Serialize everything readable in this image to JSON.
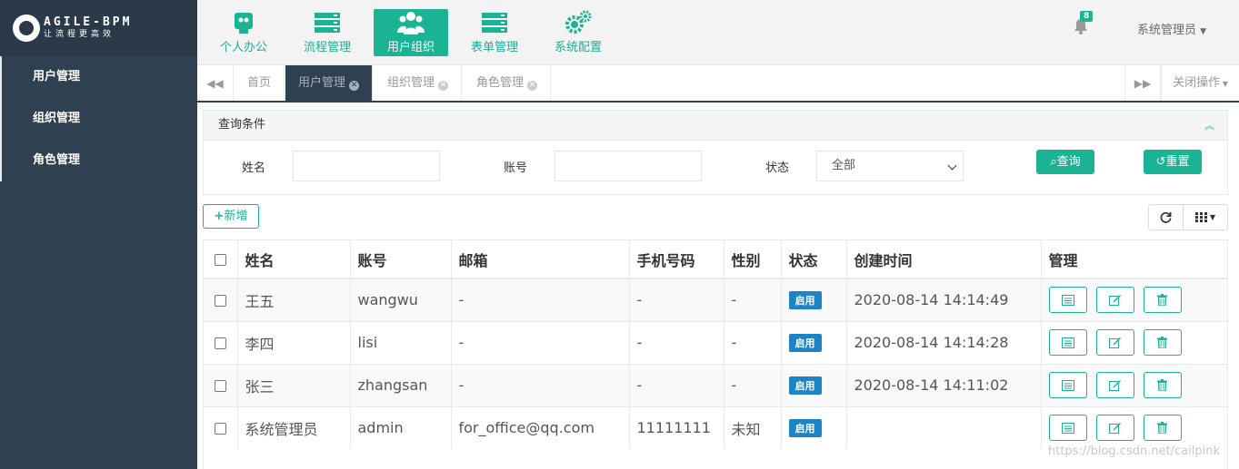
{
  "brand": {
    "name": "AGILE-BPM",
    "slogan": "让流程更高效"
  },
  "sidebar": {
    "items": [
      {
        "label": "用户管理"
      },
      {
        "label": "组织管理"
      },
      {
        "label": "角色管理"
      }
    ]
  },
  "topnav": {
    "items": [
      {
        "label": "个人办公",
        "icon": "briefcase-icon"
      },
      {
        "label": "流程管理",
        "icon": "server-icon"
      },
      {
        "label": "用户组织",
        "icon": "users-icon",
        "active": true
      },
      {
        "label": "表单管理",
        "icon": "server-icon"
      },
      {
        "label": "系统配置",
        "icon": "gears-icon"
      }
    ],
    "notification_count": "8",
    "user_name": "系统管理员"
  },
  "tabs": {
    "items": [
      {
        "label": "首页"
      },
      {
        "label": "用户管理",
        "active": true
      },
      {
        "label": "组织管理"
      },
      {
        "label": "角色管理"
      }
    ],
    "close_ops_label": "关闭操作"
  },
  "query": {
    "title": "查询条件",
    "name_label": "姓名",
    "account_label": "账号",
    "status_label": "状态",
    "status_value": "全部",
    "search_label": "查询",
    "reset_label": "重置"
  },
  "toolbar": {
    "add_label": "新增"
  },
  "table": {
    "headers": [
      "姓名",
      "账号",
      "邮箱",
      "手机号码",
      "性别",
      "状态",
      "创建时间",
      "管理"
    ],
    "rows": [
      {
        "name": "王五",
        "account": "wangwu",
        "email": "-",
        "phone": "-",
        "gender": "-",
        "status": "启用",
        "created": "2020-08-14 14:14:49"
      },
      {
        "name": "李四",
        "account": "lisi",
        "email": "-",
        "phone": "-",
        "gender": "-",
        "status": "启用",
        "created": "2020-08-14 14:14:28"
      },
      {
        "name": "张三",
        "account": "zhangsan",
        "email": "-",
        "phone": "-",
        "gender": "-",
        "status": "启用",
        "created": "2020-08-14 14:11:02"
      },
      {
        "name": "系统管理员",
        "account": "admin",
        "email": "for_office@qq.com",
        "phone": "11111111",
        "gender": "未知",
        "status": "启用",
        "created": ""
      }
    ]
  },
  "watermark": "https://blog.csdn.net/cailpink",
  "colors": {
    "accent": "#1ab394",
    "sidebar": "#2f4050",
    "badge": "#1c84c6"
  }
}
